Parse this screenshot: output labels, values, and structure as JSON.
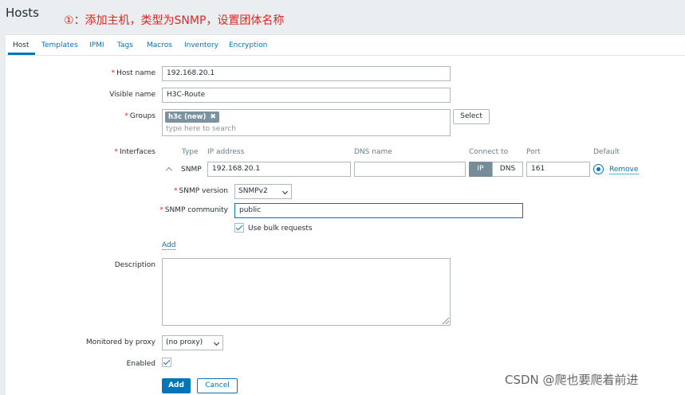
{
  "page": {
    "title": "Hosts"
  },
  "annotation": "①：添加主机，类型为SNMP，设置团体名称",
  "tabs": [
    {
      "label": "Host"
    },
    {
      "label": "Templates"
    },
    {
      "label": "IPMI"
    },
    {
      "label": "Tags"
    },
    {
      "label": "Macros"
    },
    {
      "label": "Inventory"
    },
    {
      "label": "Encryption"
    }
  ],
  "form": {
    "host_name": {
      "label": "Host name",
      "value": "192.168.20.1"
    },
    "visible_name": {
      "label": "Visible name",
      "value": "H3C-Route"
    },
    "groups": {
      "label": "Groups",
      "chip": "h3c (new)",
      "placeholder": "type here to search",
      "select_label": "Select"
    },
    "interfaces": {
      "label": "Interfaces",
      "headers": {
        "type": "Type",
        "ip": "IP address",
        "dns": "DNS name",
        "connect": "Connect to",
        "port": "Port",
        "default": "Default"
      },
      "row": {
        "type": "SNMP",
        "ip": "192.168.20.1",
        "dns": "",
        "connect_ip": "IP",
        "connect_dns": "DNS",
        "port": "161",
        "remove": "Remove"
      },
      "snmp_version": {
        "label": "SNMP version",
        "value": "SNMPv2"
      },
      "snmp_community": {
        "label": "SNMP community",
        "value": "public"
      },
      "bulk": {
        "label": "Use bulk requests"
      },
      "add_label": "Add"
    },
    "description": {
      "label": "Description"
    },
    "proxy": {
      "label": "Monitored by proxy",
      "value": "(no proxy)"
    },
    "enabled": {
      "label": "Enabled"
    },
    "buttons": {
      "add": "Add",
      "cancel": "Cancel"
    }
  },
  "watermark": "CSDN @爬也要爬着前进",
  "colors": {
    "accent": "#0275b8",
    "required": "#e8231f",
    "annotation": "#e8231f"
  }
}
